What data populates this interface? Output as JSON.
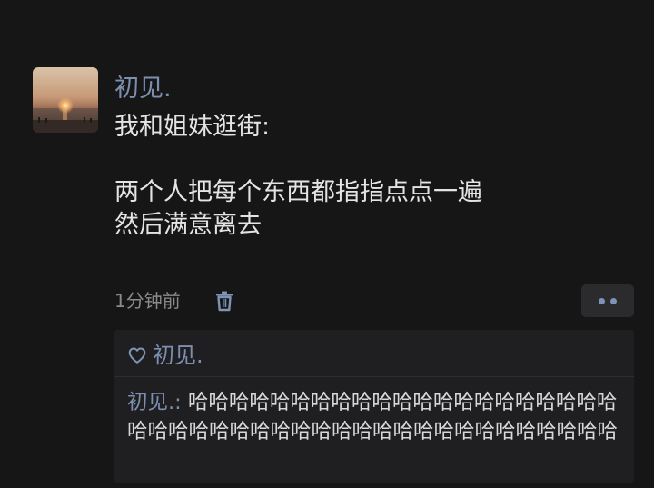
{
  "post": {
    "username": "初见.",
    "text_lines": [
      "我和姐妹逛街:",
      "",
      "两个人把每个东西都指指点点一遍",
      "然后满意离去"
    ],
    "time": "1分钟前",
    "delete_icon": "trash-icon",
    "more_icon": "more-dots-icon"
  },
  "interactions": {
    "like_icon": "heart-icon",
    "likes": "初见.",
    "comments": [
      {
        "author": "初见.",
        "separator": ": ",
        "text": "哈哈哈哈哈哈哈哈哈哈哈哈哈哈哈哈哈哈哈哈哈哈哈哈哈哈哈哈哈哈哈哈哈哈哈哈哈哈哈哈哈哈哈哈哈"
      }
    ]
  },
  "colors": {
    "background": "#161616",
    "name_link": "#7d8fb0",
    "body_text": "#e4e4e4",
    "muted": "#8a8a8a",
    "comment_box": "#1f1f21"
  }
}
